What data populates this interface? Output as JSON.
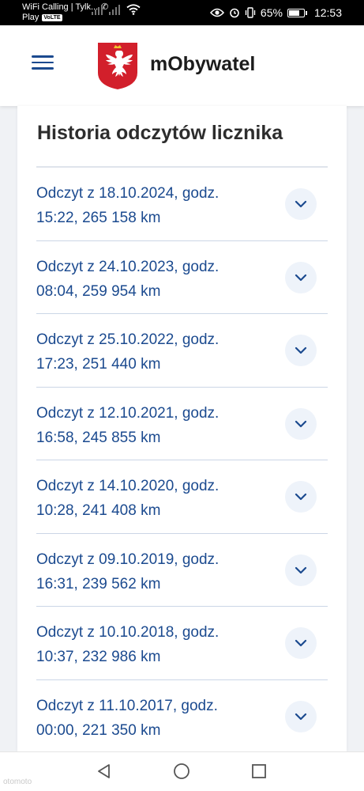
{
  "status_bar": {
    "carrier_line1": "WiFi Calling | Tylk...",
    "carrier_line2": "Play",
    "volte": "VoLTE",
    "battery": "65%",
    "time": "12:53"
  },
  "header": {
    "app_title": "mObywatel",
    "menu_icon": "hamburger-menu-icon",
    "logo_icon": "polish-eagle-emblem"
  },
  "section": {
    "title": "Historia odczytów licznika"
  },
  "readings": [
    {
      "line1": "Odczyt z 18.10.2024, godz.",
      "line2": "15:22, 265 158 km"
    },
    {
      "line1": "Odczyt z 24.10.2023, godz.",
      "line2": "08:04, 259 954 km"
    },
    {
      "line1": "Odczyt z 25.10.2022, godz.",
      "line2": "17:23, 251 440 km"
    },
    {
      "line1": "Odczyt z 12.10.2021, godz.",
      "line2": "16:58, 245 855 km"
    },
    {
      "line1": "Odczyt z 14.10.2020, godz.",
      "line2": "10:28, 241 408 km"
    },
    {
      "line1": "Odczyt z 09.10.2019, godz.",
      "line2": "16:31, 239 562 km"
    },
    {
      "line1": "Odczyt z 10.10.2018, godz.",
      "line2": "10:37, 232 986 km"
    },
    {
      "line1": "Odczyt z 11.10.2017, godz.",
      "line2": "00:00, 221 350 km"
    }
  ],
  "colors": {
    "accent": "#1b4a8f",
    "emblem_red": "#d21f2b",
    "chevron_bg": "#eef3fa"
  },
  "watermark": "otomoto"
}
